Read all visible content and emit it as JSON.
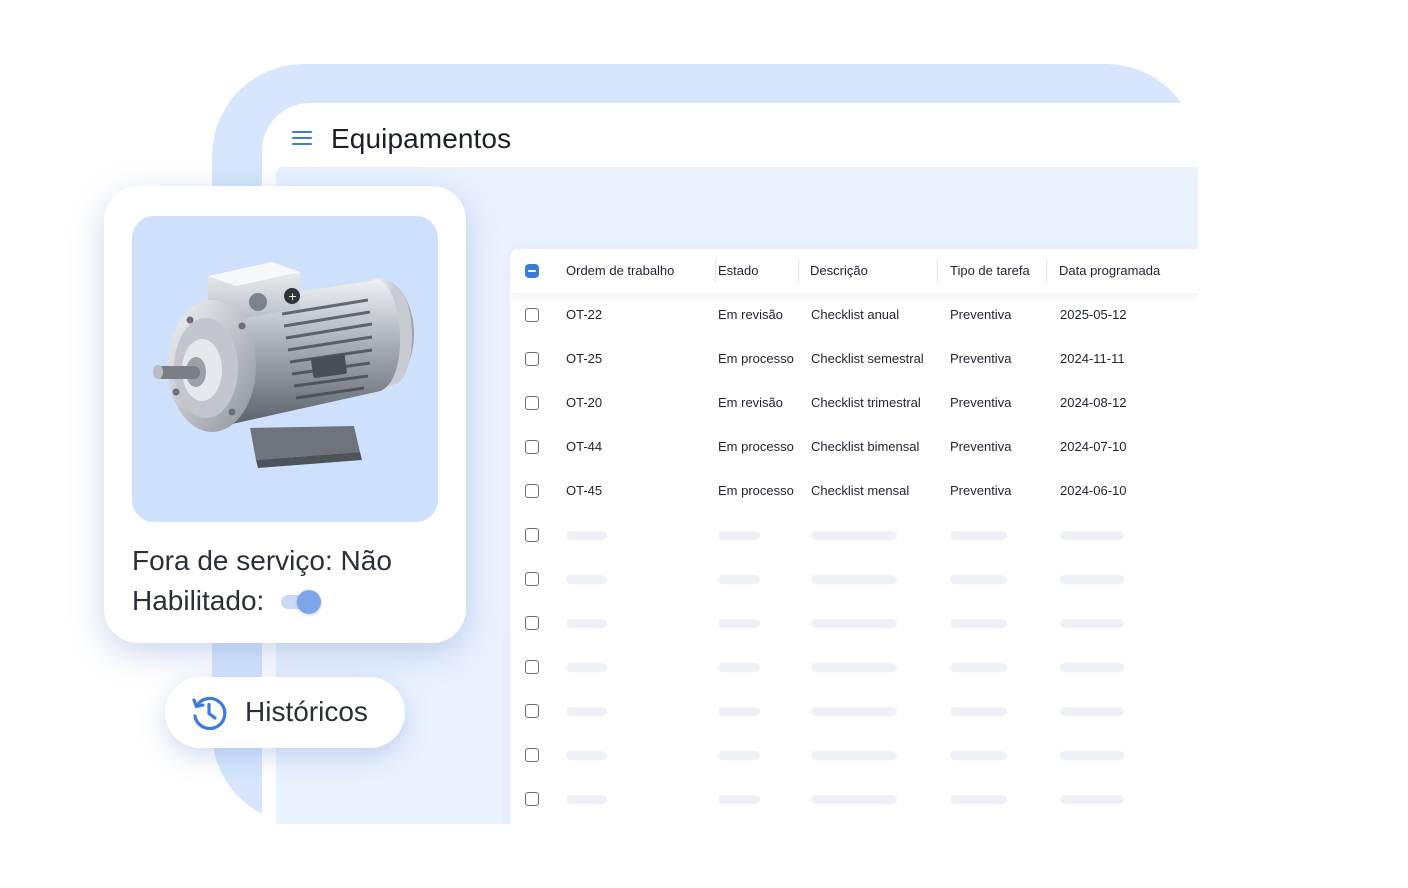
{
  "colors": {
    "accent": "#3d7bd9",
    "background_blob": "#d7e6fd",
    "content_area": "#eaf2fe",
    "motor_background": "#cfe0fd"
  },
  "header": {
    "menu_icon": "hamburger-menu-icon",
    "title": "Equipamentos"
  },
  "table": {
    "columns": [
      "Ordem de trabalho",
      "Estado",
      "Descrição",
      "Tipo de tarefa",
      "Data programada"
    ],
    "select_all_state": "indeterminate",
    "rows": [
      {
        "order": "OT-22",
        "status": "Em revisão",
        "description": "Checklist anual",
        "task_type": "Preventiva",
        "date": "2025-05-12"
      },
      {
        "order": "OT-25",
        "status": "Em processo",
        "description": "Checklist semestral",
        "task_type": "Preventiva",
        "date": "2024-11-11"
      },
      {
        "order": "OT-20",
        "status": "Em revisão",
        "description": "Checklist trimestral",
        "task_type": "Preventiva",
        "date": "2024-08-12"
      },
      {
        "order": "OT-44",
        "status": "Em processo",
        "description": "Checklist bimensal",
        "task_type": "Preventiva",
        "date": "2024-07-10"
      },
      {
        "order": "OT-45",
        "status": "Em processo",
        "description": "Checklist mensal",
        "task_type": "Preventiva",
        "date": "2024-06-10"
      }
    ],
    "placeholder_rows": 9
  },
  "equipment_card": {
    "image": "electric-motor-image",
    "out_of_service": "Fora de serviço: Não",
    "enabled_label": "Habilitado:",
    "enabled": true
  },
  "history_button": {
    "icon": "history-icon",
    "label": "Históricos"
  }
}
